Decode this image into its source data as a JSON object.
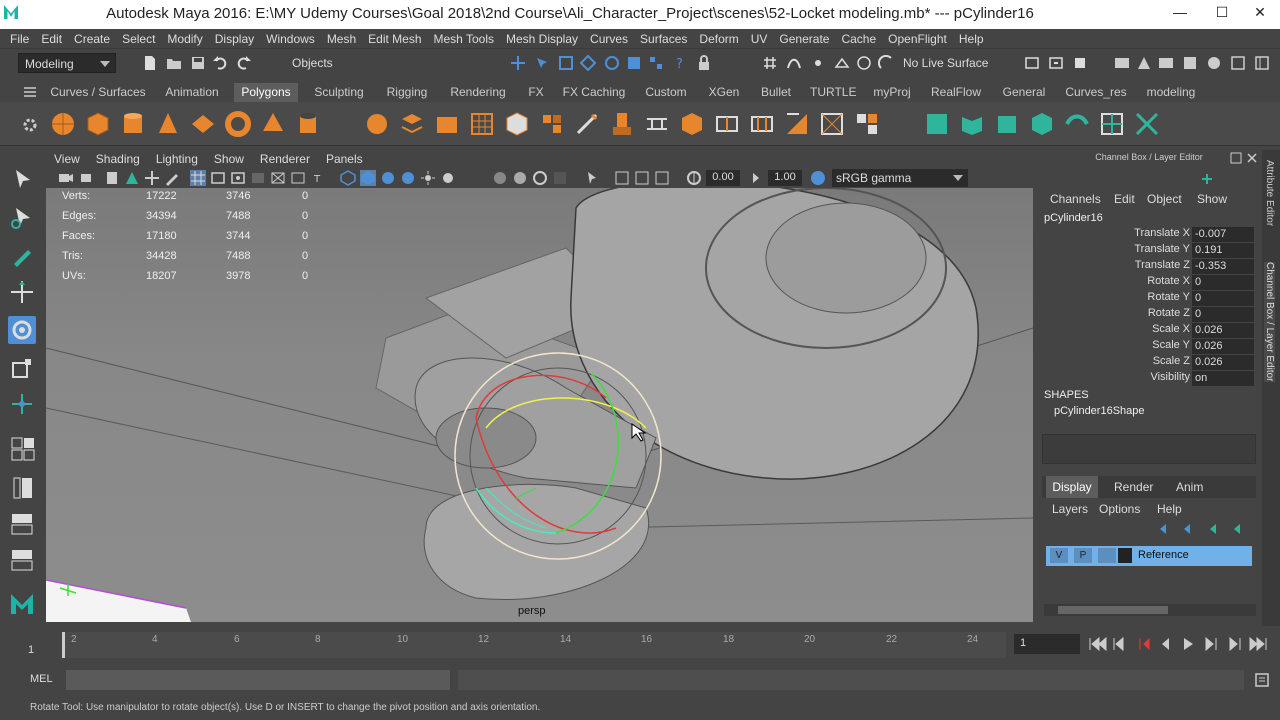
{
  "window": {
    "title": "Autodesk Maya 2016: E:\\MY Udemy Courses\\Goal 2018\\2nd Course\\Ali_Character_Project\\scenes\\52-Locket modeling.mb*   ---   pCylinder16",
    "minimize": "—",
    "maximize": "☐",
    "close": "✕"
  },
  "menubar": [
    "File",
    "Edit",
    "Create",
    "Select",
    "Modify",
    "Display",
    "Windows",
    "Mesh",
    "Edit Mesh",
    "Mesh Tools",
    "Mesh Display",
    "Curves",
    "Surfaces",
    "Deform",
    "UV",
    "Generate",
    "Cache",
    "OpenFlight",
    "Help"
  ],
  "statusline": {
    "menuset": "Modeling",
    "selmode": "Objects",
    "live_surface": "No Live Surface"
  },
  "shelf_tabs": [
    "Curves / Surfaces",
    "Animation",
    "Polygons",
    "Sculpting",
    "Rigging",
    "Rendering",
    "FX",
    "FX Caching",
    "Custom",
    "XGen",
    "Bullet",
    "TURTLE",
    "myProj",
    "RealFlow",
    "General",
    "Curves_res",
    "modeling"
  ],
  "shelf_active": "Polygons",
  "panel_menu": [
    "View",
    "Shading",
    "Lighting",
    "Show",
    "Renderer",
    "Panels"
  ],
  "panel_toolbar": {
    "exposure": "0.00",
    "gamma": "1.00",
    "color_space": "sRGB gamma"
  },
  "hud": [
    {
      "label": "Verts:",
      "c1": "17222",
      "c2": "3746",
      "c3": "0"
    },
    {
      "label": "Edges:",
      "c1": "34394",
      "c2": "7488",
      "c3": "0"
    },
    {
      "label": "Faces:",
      "c1": "17180",
      "c2": "3744",
      "c3": "0"
    },
    {
      "label": "Tris:",
      "c1": "34428",
      "c2": "7488",
      "c3": "0"
    },
    {
      "label": "UVs:",
      "c1": "18207",
      "c2": "3978",
      "c3": "0"
    }
  ],
  "camera_name": "persp",
  "channel_box": {
    "header": "Channel Box / Layer Editor",
    "menus": [
      "Channels",
      "Edit",
      "Object",
      "Show"
    ],
    "object": "pCylinder16",
    "attrs": [
      {
        "k": "Translate X",
        "v": "-0.007"
      },
      {
        "k": "Translate Y",
        "v": "0.191"
      },
      {
        "k": "Translate Z",
        "v": "-0.353"
      },
      {
        "k": "Rotate X",
        "v": "0"
      },
      {
        "k": "Rotate Y",
        "v": "0"
      },
      {
        "k": "Rotate Z",
        "v": "0"
      },
      {
        "k": "Scale X",
        "v": "0.026"
      },
      {
        "k": "Scale Y",
        "v": "0.026"
      },
      {
        "k": "Scale Z",
        "v": "0.026"
      },
      {
        "k": "Visibility",
        "v": "on"
      }
    ],
    "shapes_label": "SHAPES",
    "shape": "pCylinder16Shape"
  },
  "layer_editor": {
    "tabs": [
      "Display",
      "Render",
      "Anim"
    ],
    "active_tab": "Display",
    "menus": [
      "Layers",
      "Options",
      "Help"
    ],
    "layer": {
      "v": "V",
      "p": "P",
      "name": "Reference"
    }
  },
  "side_tabs": [
    "Attribute Editor",
    "Channel Box / Layer Editor"
  ],
  "timeline": {
    "ticks": [
      "2",
      "4",
      "6",
      "8",
      "10",
      "12",
      "14",
      "16",
      "18",
      "20",
      "22",
      "24"
    ],
    "start": "1",
    "current": "1"
  },
  "cmdline": {
    "label": "MEL"
  },
  "helpline": "Rotate Tool: Use manipulator to rotate object(s). Use D or INSERT to change the pivot position and axis orientation.",
  "colors": {
    "accent": "#4f8fd6",
    "shelf_orange": "#e8862e",
    "shelf_teal": "#2fb59c",
    "selected_layer": "#6fb1e8"
  }
}
